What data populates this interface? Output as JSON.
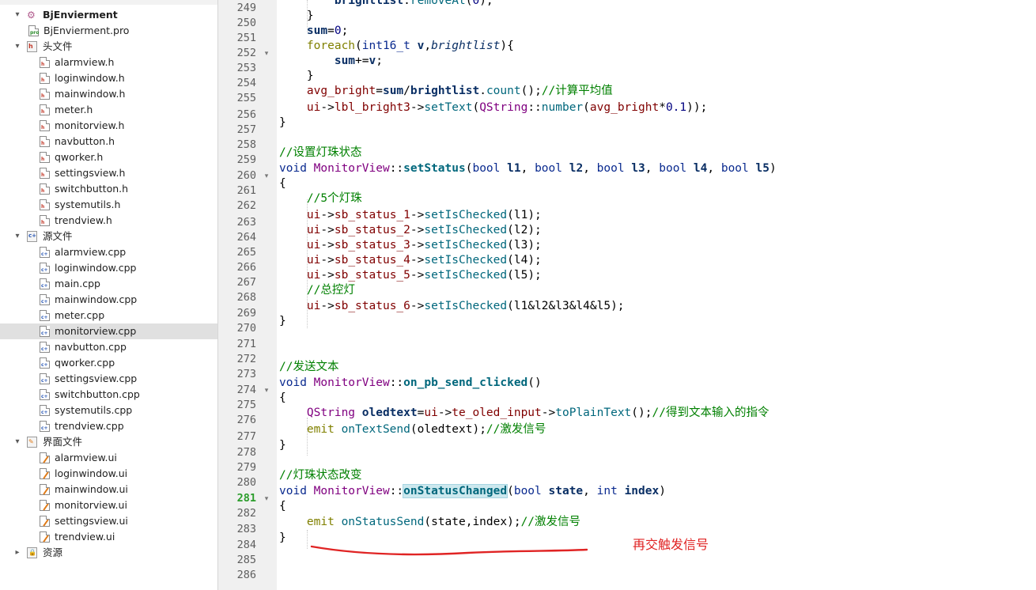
{
  "project_tree": {
    "rows": [
      {
        "label": "BjEnvierment",
        "kind": "project",
        "expand": "▾",
        "indent": 0,
        "root": true
      },
      {
        "label": "BjEnvierment.pro",
        "kind": "pro",
        "expand": "",
        "indent": 1
      },
      {
        "label": "头文件",
        "kind": "folder-h",
        "expand": "▾",
        "indent": 0
      },
      {
        "label": "alarmview.h",
        "kind": "h",
        "expand": "",
        "indent": 2
      },
      {
        "label": "loginwindow.h",
        "kind": "h",
        "expand": "",
        "indent": 2
      },
      {
        "label": "mainwindow.h",
        "kind": "h",
        "expand": "",
        "indent": 2
      },
      {
        "label": "meter.h",
        "kind": "h",
        "expand": "",
        "indent": 2
      },
      {
        "label": "monitorview.h",
        "kind": "h",
        "expand": "",
        "indent": 2
      },
      {
        "label": "navbutton.h",
        "kind": "h",
        "expand": "",
        "indent": 2
      },
      {
        "label": "qworker.h",
        "kind": "h",
        "expand": "",
        "indent": 2
      },
      {
        "label": "settingsview.h",
        "kind": "h",
        "expand": "",
        "indent": 2
      },
      {
        "label": "switchbutton.h",
        "kind": "h",
        "expand": "",
        "indent": 2
      },
      {
        "label": "systemutils.h",
        "kind": "h",
        "expand": "",
        "indent": 2
      },
      {
        "label": "trendview.h",
        "kind": "h",
        "expand": "",
        "indent": 2
      },
      {
        "label": "源文件",
        "kind": "folder-cpp",
        "expand": "▾",
        "indent": 0
      },
      {
        "label": "alarmview.cpp",
        "kind": "cpp",
        "expand": "",
        "indent": 2
      },
      {
        "label": "loginwindow.cpp",
        "kind": "cpp",
        "expand": "",
        "indent": 2
      },
      {
        "label": "main.cpp",
        "kind": "cpp",
        "expand": "",
        "indent": 2
      },
      {
        "label": "mainwindow.cpp",
        "kind": "cpp",
        "expand": "",
        "indent": 2
      },
      {
        "label": "meter.cpp",
        "kind": "cpp",
        "expand": "",
        "indent": 2
      },
      {
        "label": "monitorview.cpp",
        "kind": "cpp",
        "expand": "",
        "indent": 2,
        "selected": true
      },
      {
        "label": "navbutton.cpp",
        "kind": "cpp",
        "expand": "",
        "indent": 2
      },
      {
        "label": "qworker.cpp",
        "kind": "cpp",
        "expand": "",
        "indent": 2
      },
      {
        "label": "settingsview.cpp",
        "kind": "cpp",
        "expand": "",
        "indent": 2
      },
      {
        "label": "switchbutton.cpp",
        "kind": "cpp",
        "expand": "",
        "indent": 2
      },
      {
        "label": "systemutils.cpp",
        "kind": "cpp",
        "expand": "",
        "indent": 2
      },
      {
        "label": "trendview.cpp",
        "kind": "cpp",
        "expand": "",
        "indent": 2
      },
      {
        "label": "界面文件",
        "kind": "folder-ui",
        "expand": "▾",
        "indent": 0
      },
      {
        "label": "alarmview.ui",
        "kind": "ui",
        "expand": "",
        "indent": 2
      },
      {
        "label": "loginwindow.ui",
        "kind": "ui",
        "expand": "",
        "indent": 2
      },
      {
        "label": "mainwindow.ui",
        "kind": "ui",
        "expand": "",
        "indent": 2
      },
      {
        "label": "monitorview.ui",
        "kind": "ui",
        "expand": "",
        "indent": 2
      },
      {
        "label": "settingsview.ui",
        "kind": "ui",
        "expand": "",
        "indent": 2
      },
      {
        "label": "trendview.ui",
        "kind": "ui",
        "expand": "",
        "indent": 2
      },
      {
        "label": "资源",
        "kind": "folder-res",
        "expand": "▸",
        "indent": 0
      }
    ]
  },
  "editor": {
    "current_line": "281",
    "lines": [
      {
        "n": "249",
        "fold": "",
        "tokens": [
          [
            "",
            "        "
          ],
          [
            "pm",
            "brightlist"
          ],
          [
            "",
            "."
          ],
          [
            "fn",
            "removeAt"
          ],
          [
            "",
            "("
          ],
          [
            "nm",
            "0"
          ],
          [
            "",
            ");"
          ]
        ]
      },
      {
        "n": "250",
        "fold": "",
        "tokens": [
          [
            "",
            "    }"
          ]
        ]
      },
      {
        "n": "251",
        "fold": "",
        "tokens": [
          [
            "",
            "    "
          ],
          [
            "pm",
            "sum"
          ],
          [
            "",
            "="
          ],
          [
            "nm",
            "0"
          ],
          [
            "",
            ";"
          ]
        ]
      },
      {
        "n": "252",
        "fold": "▾",
        "tokens": [
          [
            "",
            "    "
          ],
          [
            "kw",
            "foreach"
          ],
          [
            "",
            "("
          ],
          [
            "ty",
            "int16_t"
          ],
          [
            "",
            " "
          ],
          [
            "pm",
            "v"
          ],
          [
            "",
            ","
          ],
          [
            "it",
            "brightlist"
          ],
          [
            "",
            "){"
          ]
        ]
      },
      {
        "n": "253",
        "fold": "",
        "tokens": [
          [
            "",
            "        "
          ],
          [
            "pm",
            "sum"
          ],
          [
            "",
            "+="
          ],
          [
            "pm",
            "v"
          ],
          [
            "",
            ";"
          ]
        ]
      },
      {
        "n": "254",
        "fold": "",
        "tokens": [
          [
            "",
            "    }"
          ]
        ]
      },
      {
        "n": "255",
        "fold": "",
        "tokens": [
          [
            "",
            "    "
          ],
          [
            "mb",
            "avg_bright"
          ],
          [
            "",
            "="
          ],
          [
            "pm",
            "sum"
          ],
          [
            "",
            "/"
          ],
          [
            "pm",
            "brightlist"
          ],
          [
            "",
            "."
          ],
          [
            "fn",
            "count"
          ],
          [
            "",
            "();"
          ],
          [
            "cm",
            "//计算平均值"
          ]
        ]
      },
      {
        "n": "256",
        "fold": "",
        "tokens": [
          [
            "",
            "    "
          ],
          [
            "mb",
            "ui"
          ],
          [
            "",
            "->"
          ],
          [
            "mb",
            "lbl_bright3"
          ],
          [
            "",
            "->"
          ],
          [
            "fn",
            "setText"
          ],
          [
            "",
            "("
          ],
          [
            "qt",
            "QString"
          ],
          [
            "",
            "::"
          ],
          [
            "fn",
            "number"
          ],
          [
            "",
            "("
          ],
          [
            "mb",
            "avg_bright"
          ],
          [
            "",
            "*"
          ],
          [
            "nm",
            "0.1"
          ],
          [
            "",
            "));"
          ]
        ]
      },
      {
        "n": "257",
        "fold": "",
        "tokens": [
          [
            "",
            "}"
          ]
        ]
      },
      {
        "n": "258",
        "fold": "",
        "tokens": []
      },
      {
        "n": "259",
        "fold": "",
        "tokens": [
          [
            "cm",
            "//设置灯珠状态"
          ]
        ]
      },
      {
        "n": "260",
        "fold": "▾",
        "tokens": [
          [
            "ty",
            "void"
          ],
          [
            "",
            " "
          ],
          [
            "qt",
            "MonitorView"
          ],
          [
            "",
            "::"
          ],
          [
            "fnb",
            "setStatus"
          ],
          [
            "",
            "("
          ],
          [
            "ty",
            "bool"
          ],
          [
            "",
            " "
          ],
          [
            "pm",
            "l1"
          ],
          [
            "",
            ", "
          ],
          [
            "ty",
            "bool"
          ],
          [
            "",
            " "
          ],
          [
            "pm",
            "l2"
          ],
          [
            "",
            ", "
          ],
          [
            "ty",
            "bool"
          ],
          [
            "",
            " "
          ],
          [
            "pm",
            "l3"
          ],
          [
            "",
            ", "
          ],
          [
            "ty",
            "bool"
          ],
          [
            "",
            " "
          ],
          [
            "pm",
            "l4"
          ],
          [
            "",
            ", "
          ],
          [
            "ty",
            "bool"
          ],
          [
            "",
            " "
          ],
          [
            "pm",
            "l5"
          ],
          [
            "",
            ")"
          ]
        ]
      },
      {
        "n": "261",
        "fold": "",
        "tokens": [
          [
            "",
            "{"
          ]
        ]
      },
      {
        "n": "262",
        "fold": "",
        "tokens": [
          [
            "",
            "    "
          ],
          [
            "cm",
            "//5个灯珠"
          ]
        ]
      },
      {
        "n": "263",
        "fold": "",
        "tokens": [
          [
            "",
            "    "
          ],
          [
            "mb",
            "ui"
          ],
          [
            "",
            "->"
          ],
          [
            "mb",
            "sb_status_1"
          ],
          [
            "",
            "->"
          ],
          [
            "fn",
            "setIsChecked"
          ],
          [
            "",
            "(l1);"
          ]
        ]
      },
      {
        "n": "264",
        "fold": "",
        "tokens": [
          [
            "",
            "    "
          ],
          [
            "mb",
            "ui"
          ],
          [
            "",
            "->"
          ],
          [
            "mb",
            "sb_status_2"
          ],
          [
            "",
            "->"
          ],
          [
            "fn",
            "setIsChecked"
          ],
          [
            "",
            "(l2);"
          ]
        ]
      },
      {
        "n": "265",
        "fold": "",
        "tokens": [
          [
            "",
            "    "
          ],
          [
            "mb",
            "ui"
          ],
          [
            "",
            "->"
          ],
          [
            "mb",
            "sb_status_3"
          ],
          [
            "",
            "->"
          ],
          [
            "fn",
            "setIsChecked"
          ],
          [
            "",
            "(l3);"
          ]
        ]
      },
      {
        "n": "266",
        "fold": "",
        "tokens": [
          [
            "",
            "    "
          ],
          [
            "mb",
            "ui"
          ],
          [
            "",
            "->"
          ],
          [
            "mb",
            "sb_status_4"
          ],
          [
            "",
            "->"
          ],
          [
            "fn",
            "setIsChecked"
          ],
          [
            "",
            "(l4);"
          ]
        ]
      },
      {
        "n": "267",
        "fold": "",
        "tokens": [
          [
            "",
            "    "
          ],
          [
            "mb",
            "ui"
          ],
          [
            "",
            "->"
          ],
          [
            "mb",
            "sb_status_5"
          ],
          [
            "",
            "->"
          ],
          [
            "fn",
            "setIsChecked"
          ],
          [
            "",
            "(l5);"
          ]
        ]
      },
      {
        "n": "268",
        "fold": "",
        "tokens": [
          [
            "",
            "    "
          ],
          [
            "cm",
            "//总控灯"
          ]
        ]
      },
      {
        "n": "269",
        "fold": "",
        "tokens": [
          [
            "",
            "    "
          ],
          [
            "mb",
            "ui"
          ],
          [
            "",
            "->"
          ],
          [
            "mb",
            "sb_status_6"
          ],
          [
            "",
            "->"
          ],
          [
            "fn",
            "setIsChecked"
          ],
          [
            "",
            "(l1&l2&l3&l4&l5);"
          ]
        ]
      },
      {
        "n": "270",
        "fold": "",
        "tokens": [
          [
            "",
            "}"
          ]
        ]
      },
      {
        "n": "271",
        "fold": "",
        "tokens": []
      },
      {
        "n": "272",
        "fold": "",
        "tokens": []
      },
      {
        "n": "273",
        "fold": "",
        "tokens": [
          [
            "cm",
            "//发送文本"
          ]
        ]
      },
      {
        "n": "274",
        "fold": "▾",
        "tokens": [
          [
            "ty",
            "void"
          ],
          [
            "",
            " "
          ],
          [
            "qt",
            "MonitorView"
          ],
          [
            "",
            "::"
          ],
          [
            "fnb",
            "on_pb_send_clicked"
          ],
          [
            "",
            "()"
          ]
        ]
      },
      {
        "n": "275",
        "fold": "",
        "tokens": [
          [
            "",
            "{"
          ]
        ]
      },
      {
        "n": "276",
        "fold": "",
        "tokens": [
          [
            "",
            "    "
          ],
          [
            "qt",
            "QString"
          ],
          [
            "",
            " "
          ],
          [
            "pm",
            "oledtext"
          ],
          [
            "",
            "="
          ],
          [
            "mb",
            "ui"
          ],
          [
            "",
            "->"
          ],
          [
            "mb",
            "te_oled_input"
          ],
          [
            "",
            "->"
          ],
          [
            "fn",
            "toPlainText"
          ],
          [
            "",
            "();"
          ],
          [
            "cm",
            "//得到文本输入的指令"
          ]
        ]
      },
      {
        "n": "277",
        "fold": "",
        "tokens": [
          [
            "",
            "    "
          ],
          [
            "kw",
            "emit"
          ],
          [
            "",
            " "
          ],
          [
            "fn",
            "onTextSend"
          ],
          [
            "",
            "(oledtext);"
          ],
          [
            "cm",
            "//激发信号"
          ]
        ]
      },
      {
        "n": "278",
        "fold": "",
        "tokens": [
          [
            "",
            "}"
          ]
        ]
      },
      {
        "n": "279",
        "fold": "",
        "tokens": []
      },
      {
        "n": "280",
        "fold": "",
        "tokens": [
          [
            "cm",
            "//灯珠状态改变"
          ]
        ]
      },
      {
        "n": "281",
        "fold": "▾",
        "tokens": [
          [
            "ty",
            "void"
          ],
          [
            "",
            " "
          ],
          [
            "qt",
            "MonitorView"
          ],
          [
            "",
            "::"
          ],
          [
            "hl-fnb",
            "onStatusChanged"
          ],
          [
            "",
            "("
          ],
          [
            "ty",
            "bool"
          ],
          [
            "",
            " "
          ],
          [
            "pm",
            "state"
          ],
          [
            "",
            ", "
          ],
          [
            "ty",
            "int"
          ],
          [
            "",
            " "
          ],
          [
            "pm",
            "index"
          ],
          [
            "",
            ")"
          ]
        ]
      },
      {
        "n": "282",
        "fold": "",
        "tokens": [
          [
            "",
            "{"
          ]
        ]
      },
      {
        "n": "283",
        "fold": "",
        "tokens": [
          [
            "",
            "    "
          ],
          [
            "kw",
            "emit"
          ],
          [
            "",
            " "
          ],
          [
            "fn",
            "onStatusSend"
          ],
          [
            "",
            "(state,index);"
          ],
          [
            "cm",
            "//激发信号"
          ]
        ]
      },
      {
        "n": "284",
        "fold": "",
        "tokens": [
          [
            "",
            "}"
          ]
        ]
      },
      {
        "n": "285",
        "fold": "",
        "tokens": []
      },
      {
        "n": "286",
        "fold": "",
        "tokens": []
      }
    ]
  },
  "annotation": {
    "text": "再交触发信号",
    "color": "#e02424"
  },
  "colors": {
    "selection": "#e0e0e0",
    "gutter": "#f0f0f0",
    "current_line_number": "#2b9d2b",
    "symbol_highlight": "#cce8ee"
  }
}
